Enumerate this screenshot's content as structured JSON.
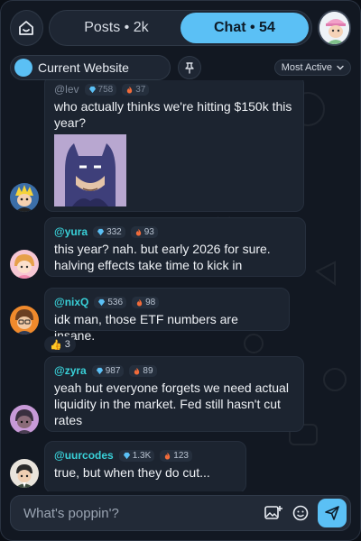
{
  "header": {
    "tabs": [
      {
        "label": "Posts • 2k",
        "active": false
      },
      {
        "label": "Chat • 54",
        "active": true
      }
    ]
  },
  "filter": {
    "site_label": "Current Website",
    "sort_label": "Most Active"
  },
  "messages": [
    {
      "username": "@lev",
      "gems": "758",
      "fire": "37",
      "text": "who actually thinks we're hitting $150k this year?",
      "has_image": true
    },
    {
      "username": "@yura",
      "gems": "332",
      "fire": "93",
      "text": "this year? nah. but early 2026 for sure. halving effects take time to kick in"
    },
    {
      "username": "@nixQ",
      "gems": "536",
      "fire": "98",
      "text": "idk man, those ETF numbers are insane.",
      "reaction_count": "3"
    },
    {
      "username": "@zyra",
      "gems": "987",
      "fire": "89",
      "text": "yeah but everyone forgets we need actual liquidity in the market. Fed still hasn't cut rates"
    },
    {
      "username": "@uurcodes",
      "gems": "1.3K",
      "fire": "123",
      "text": "true, but when they do cut..."
    }
  ],
  "composer": {
    "placeholder": "What's poppin'?"
  },
  "colors": {
    "accent": "#5bc0f5",
    "username": "#39d0d8",
    "background": "#121822",
    "bubble": "#1c2430"
  }
}
